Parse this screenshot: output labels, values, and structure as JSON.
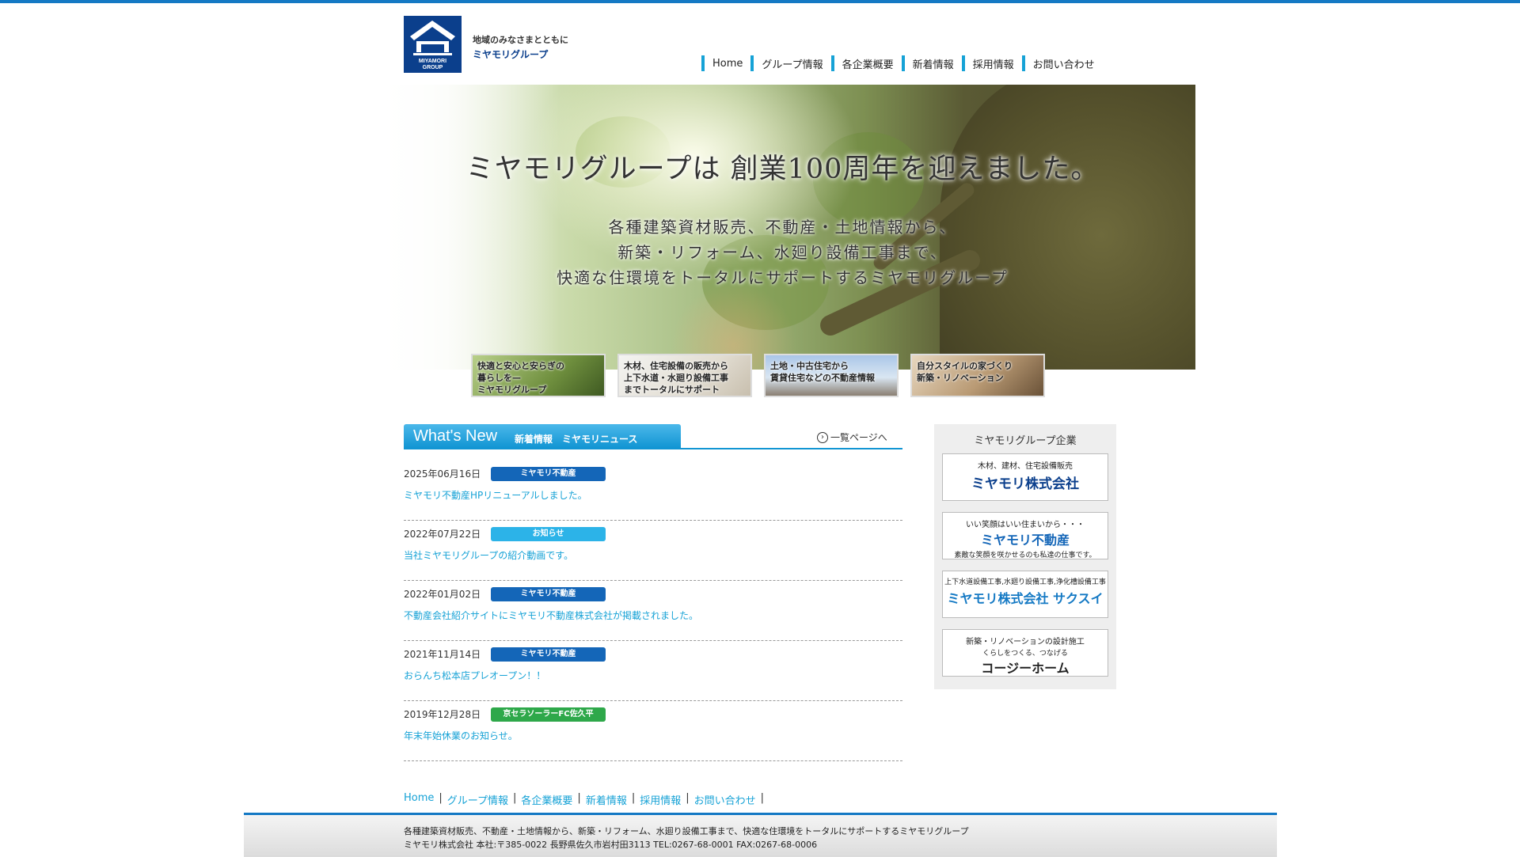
{
  "header": {
    "logo_text_1": "MIYAMORI",
    "logo_text_2": "GROUP",
    "tagline": "地域のみなさまとともに",
    "brand": "ミヤモリグループ"
  },
  "nav": {
    "items": [
      {
        "label": "Home"
      },
      {
        "label": "グループ情報"
      },
      {
        "label": "各企業概要"
      },
      {
        "label": "新着情報"
      },
      {
        "label": "採用情報"
      },
      {
        "label": "お問い合わせ"
      }
    ]
  },
  "hero": {
    "title": "ミヤモリグループは 創業100周年を迎えました。",
    "lines": [
      "各種建築資材販売、不動産・土地情報から、",
      "新築・リフォーム、水廻り設備工事まで、",
      "快適な住環境をトータルにサポートするミヤモリグループ"
    ]
  },
  "banners": [
    {
      "text": "快適と安心と安らぎの\n暮らしを—\nミヤモリグループ"
    },
    {
      "text": "木材、住宅設備の販売から\n上下水道・水廻り設備工事\nまでトータルにサポート"
    },
    {
      "text": "土地・中古住宅から\n賃貸住宅などの不動産情報"
    },
    {
      "text": "自分スタイルの家づくり\n新築・リノベーション"
    }
  ],
  "news": {
    "heading_en": "What's New",
    "heading_jp": "新着情報　ミヤモリニュース",
    "more_label": "一覧ページへ",
    "items": [
      {
        "date": "2025年06月16日",
        "category": "ミヤモリ不動産",
        "title": "ミヤモリ不動産HPリニューアルしました。"
      },
      {
        "date": "2022年07月22日",
        "category": "お知らせ",
        "title": "当社ミヤモリグループの紹介動画です。"
      },
      {
        "date": "2022年01月02日",
        "category": "ミヤモリ不動産",
        "title": "不動産会社紹介サイトにミヤモリ不動産株式会社が掲載されました。"
      },
      {
        "date": "2021年11月14日",
        "category": "ミヤモリ不動産",
        "title": "おらんち松本店プレオープン！！"
      },
      {
        "date": "2019年12月28日",
        "category": "京セラソーラーFC佐久平",
        "title": "年末年始休業のお知らせ。"
      }
    ]
  },
  "colors": {
    "accent": "#1479c4",
    "nav_bar": "#16a2d6",
    "badge_fudosan": "#1466b8",
    "badge_oshirase": "#2cb3e8",
    "badge_kyocera": "#2ea84a",
    "logo": "#0b3f8c"
  },
  "side": {
    "title": "ミヤモリグループ企業",
    "companies": [
      {
        "top": "木材、建材、住宅設備販売",
        "name": "ミヤモリ株式会社",
        "sub": ""
      },
      {
        "top": "いい笑顔はいい住まいから・・・",
        "name": "ミヤモリ不動産",
        "sub": "素敵な笑顔を咲かせるのも私達の仕事です。"
      },
      {
        "top": "上下水道設備工事,水廻り設備工事,浄化槽設備工事",
        "name": "ミヤモリ株式会社 サクスイ",
        "sub": ""
      },
      {
        "top": "新築・リノベーションの設計施工",
        "name": "コージーホーム",
        "sub": "くらしをつくる、つなげる"
      }
    ]
  },
  "footer": {
    "nav": [
      {
        "label": "Home"
      },
      {
        "label": "グループ情報"
      },
      {
        "label": "各企業概要"
      },
      {
        "label": "新着情報"
      },
      {
        "label": "採用情報"
      },
      {
        "label": "お問い合わせ"
      }
    ],
    "line1": "各種建築資材販売、不動産・土地情報から、新築・リフォーム、水廻り設備工事まで、快適な住環境をトータルにサポートするミヤモリグループ",
    "line2": "ミヤモリ株式会社 本社:〒385-0022 長野県佐久市岩村田3113 TEL:0267-68-0001 FAX:0267-68-0006"
  }
}
